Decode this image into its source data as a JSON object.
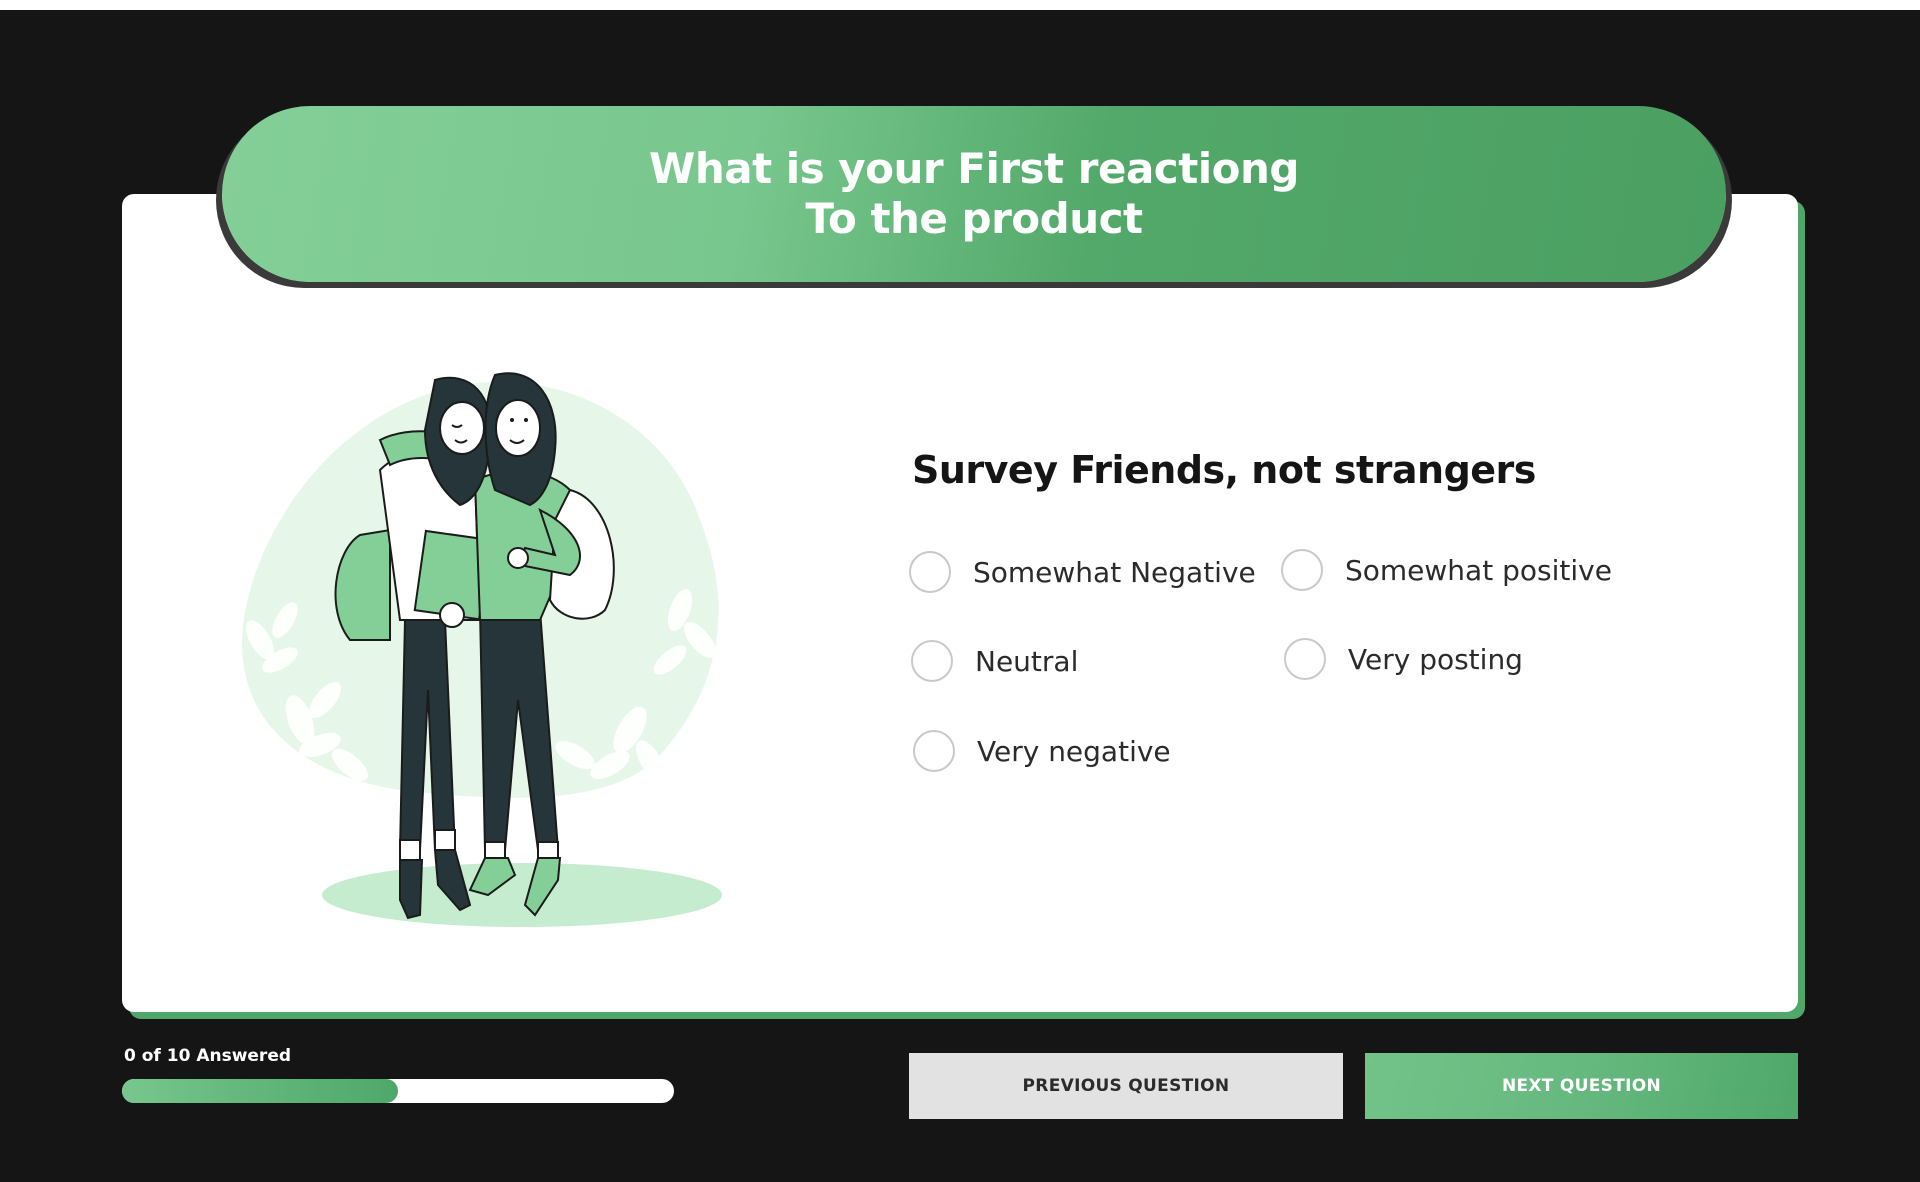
{
  "header": {
    "title_line1": "What is your First reactiong",
    "title_line2": "To the product"
  },
  "survey": {
    "title": "Survey Friends, not strangers",
    "options": [
      {
        "label": "Somewhat Negative"
      },
      {
        "label": "Somewhat positive"
      },
      {
        "label": "Neutral"
      },
      {
        "label": "Very posting"
      },
      {
        "label": "Very negative"
      }
    ]
  },
  "progress": {
    "label": "0 of 10 Answered",
    "fill_fraction": 0.5
  },
  "buttons": {
    "previous": "PREVIOUS QUESTION",
    "next": "NEXT QUESTION"
  },
  "colors": {
    "background": "#151515",
    "accent_green": "#4fa86a",
    "accent_light_green": "#78c78e"
  },
  "illustration": {
    "description_icon": "two-friends-hugging-illustration"
  }
}
